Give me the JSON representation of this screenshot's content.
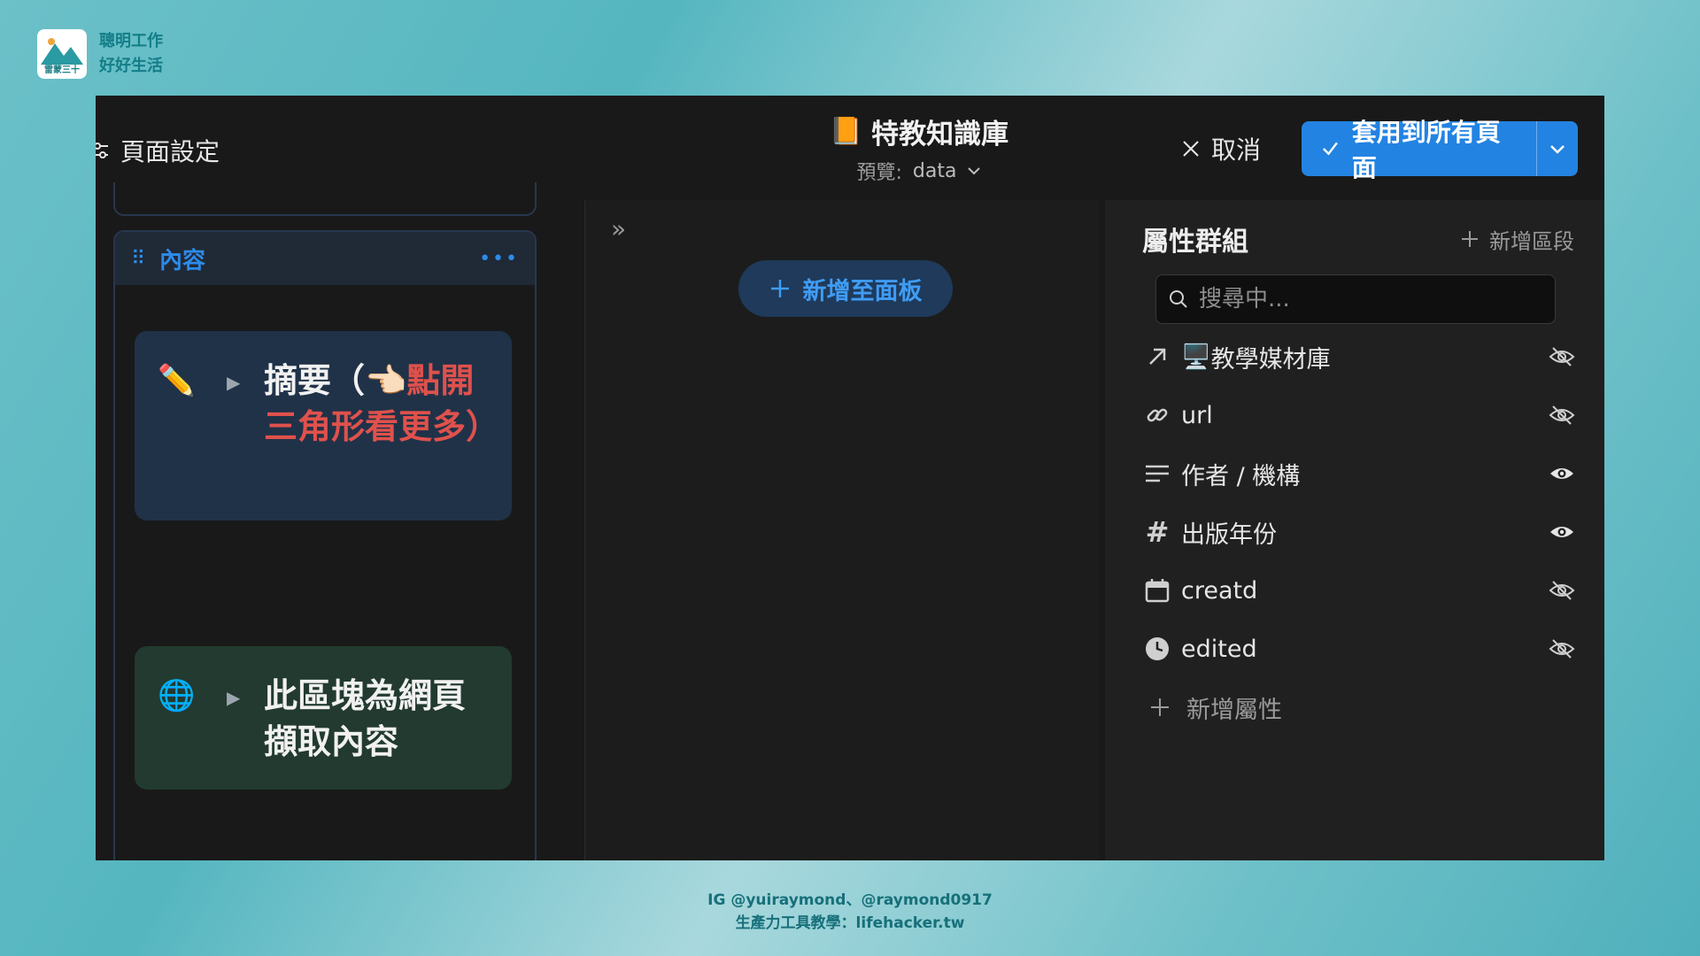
{
  "brand": {
    "logo_text": "雷蒙三十",
    "line1": "聰明工作",
    "line2": "好好生活"
  },
  "topbar": {
    "page_settings_label": "頁面設定",
    "title": "特教知識庫",
    "title_icon": "📙",
    "preview_label": "預覽:",
    "preview_value": "data",
    "cancel_label": "取消",
    "apply_label": "套用到所有頁面"
  },
  "left": {
    "panel_title": "內容",
    "blocks": [
      {
        "emoji": "✏️",
        "text_prefix": "摘要（",
        "hand": "👈🏻",
        "text_highlight": "點開三角形看更多）"
      },
      {
        "emoji": "🌐",
        "text": "此區塊為網頁擷取內容"
      }
    ]
  },
  "middle": {
    "add_board_label": "新增至面板"
  },
  "right": {
    "title": "屬性群組",
    "add_section_label": "新增區段",
    "search_placeholder": "搜尋中...",
    "properties": [
      {
        "icon": "arrow-up-right-icon",
        "emoji": "🖥️",
        "name": "教學媒材庫",
        "visible": false
      },
      {
        "icon": "link-icon",
        "name": "url",
        "visible": false
      },
      {
        "icon": "text-lines-icon",
        "name": "作者 / 機構",
        "visible": true
      },
      {
        "icon": "hash-icon",
        "name": "出版年份",
        "visible": true
      },
      {
        "icon": "calendar-icon",
        "name": "creatd",
        "visible": false
      },
      {
        "icon": "clock-icon",
        "name": "edited",
        "visible": false
      }
    ],
    "add_property_label": "新增屬性"
  },
  "footer": {
    "line1": "IG @yuiraymond、@raymond0917",
    "line2": "生產力工具教學：lifehacker.tw"
  },
  "colors": {
    "accent": "#2383e2",
    "red_text": "#e0514c",
    "brand_teal": "#137e88"
  }
}
